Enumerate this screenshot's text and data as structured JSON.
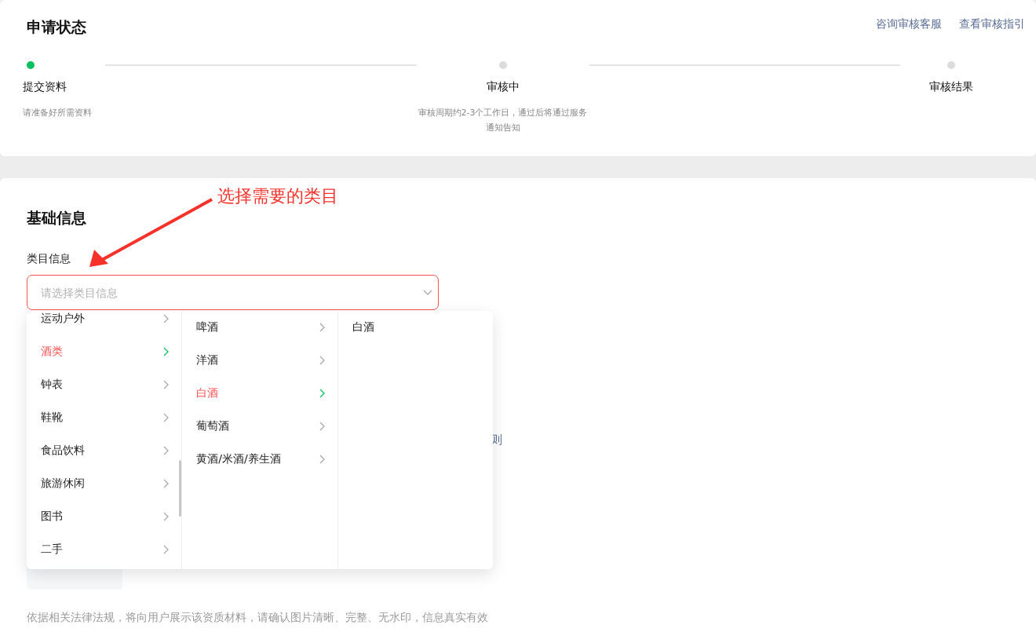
{
  "header": {
    "title": "申请状态",
    "links": [
      "咨询审核客服",
      "查看审核指引"
    ]
  },
  "steps": [
    {
      "label": "提交资料",
      "description": "请准备好所需资料",
      "active": true
    },
    {
      "label": "审核中",
      "description": "审核周期约2-3个工作日，通过后将通过服务通知告知",
      "active": false
    },
    {
      "label": "审核结果",
      "active": false
    }
  ],
  "basic_info": {
    "title": "基础信息",
    "annotation": "选择需要的类目",
    "field_label": "类目信息",
    "select": {
      "placeholder": "请选择类目信息"
    },
    "hidden_text": "则",
    "note": "依据相关法律法规，将向用户展示该资质材料，请确认图片清晰、完整、无水印，信息真实有效"
  },
  "dropdown": {
    "columns": [
      {
        "items": [
          {
            "label": "运动户外",
            "selected": false,
            "has_children": true
          },
          {
            "label": "酒类",
            "selected": true,
            "has_children": true
          },
          {
            "label": "钟表",
            "selected": false,
            "has_children": true
          },
          {
            "label": "鞋靴",
            "selected": false,
            "has_children": true
          },
          {
            "label": "食品饮料",
            "selected": false,
            "has_children": true
          },
          {
            "label": "旅游休闲",
            "selected": false,
            "has_children": true
          },
          {
            "label": "图书",
            "selected": false,
            "has_children": true
          },
          {
            "label": "二手",
            "selected": false,
            "has_children": true
          }
        ]
      },
      {
        "items": [
          {
            "label": "啤酒",
            "selected": false,
            "has_children": true
          },
          {
            "label": "洋酒",
            "selected": false,
            "has_children": true
          },
          {
            "label": "白酒",
            "selected": true,
            "has_children": true
          },
          {
            "label": "葡萄酒",
            "selected": false,
            "has_children": true
          },
          {
            "label": "黄酒/米酒/养生酒",
            "selected": false,
            "has_children": true
          }
        ]
      },
      {
        "items": [
          {
            "label": "白酒",
            "selected": false,
            "has_children": false
          }
        ]
      }
    ]
  }
}
